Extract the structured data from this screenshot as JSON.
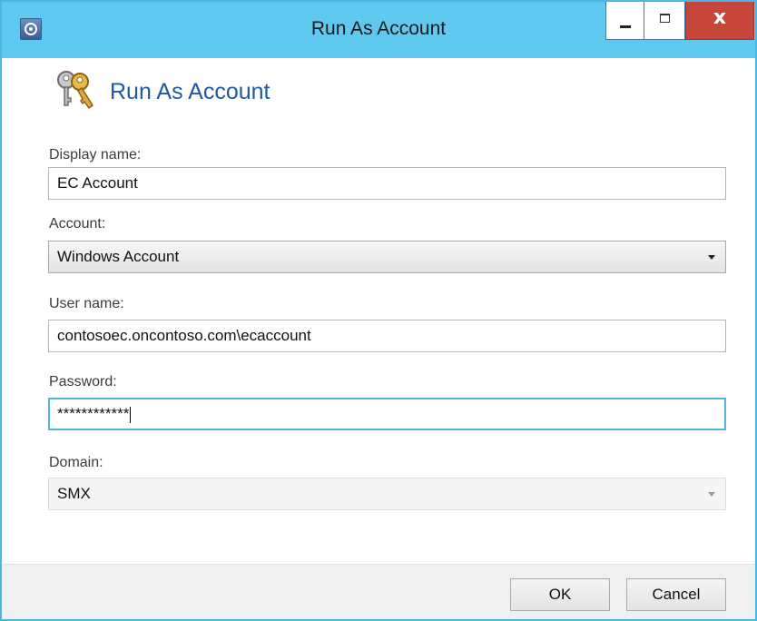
{
  "window": {
    "title": "Run As Account",
    "app_icon": "app-icon",
    "controls": {
      "minimize": "minimize-icon",
      "maximize": "maximize-icon",
      "close": "close-icon",
      "close_glyph": "x"
    }
  },
  "header": {
    "icon": "keys-icon",
    "title": "Run As Account"
  },
  "form": {
    "display_name": {
      "label": "Display name:",
      "value": "EC Account"
    },
    "account": {
      "label": "Account:",
      "value": "Windows Account"
    },
    "user_name": {
      "label": "User name:",
      "value": "contosoec.oncontoso.com\\ecaccount"
    },
    "password": {
      "label": "Password:",
      "value": "************"
    },
    "domain": {
      "label": "Domain:",
      "value": "SMX"
    }
  },
  "buttons": {
    "ok": "OK",
    "cancel": "Cancel"
  },
  "colors": {
    "titlebar": "#5ec8ef",
    "close_button": "#c7463c",
    "header_title": "#1f58a6",
    "focus_border": "#55b4e3"
  }
}
